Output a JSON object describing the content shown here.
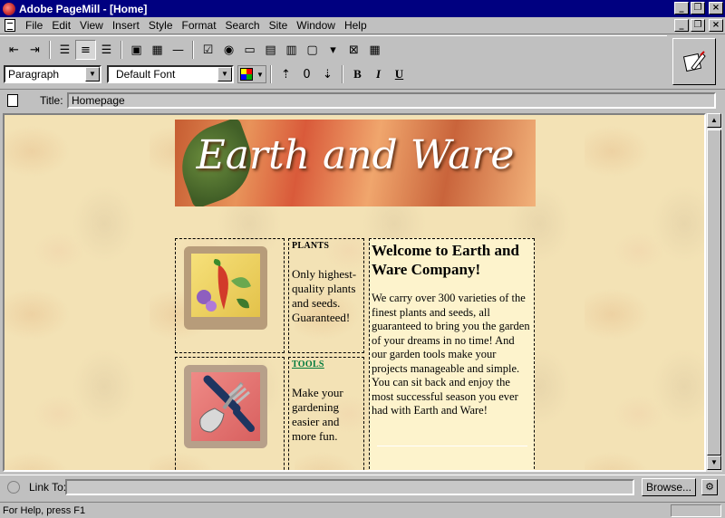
{
  "window": {
    "title": "Adobe PageMill - [Home]"
  },
  "menu": {
    "items": [
      {
        "label": "File"
      },
      {
        "label": "Edit"
      },
      {
        "label": "View"
      },
      {
        "label": "Insert"
      },
      {
        "label": "Style"
      },
      {
        "label": "Format"
      },
      {
        "label": "Search"
      },
      {
        "label": "Site"
      },
      {
        "label": "Window"
      },
      {
        "label": "Help"
      }
    ]
  },
  "toolbar": {
    "paragraph_format": "Paragraph",
    "font": "Default Font",
    "bold_label": "B",
    "italic_label": "I",
    "underline_label": "U",
    "font_size_glyph": "0"
  },
  "page": {
    "title_label": "Title:",
    "title_value": "Homepage"
  },
  "content": {
    "banner_text": "Earth and Ware",
    "plants": {
      "heading": "PLANTS",
      "text": "Only highest-quality plants and seeds. Guaranteed!"
    },
    "tools": {
      "heading": "TOOLS",
      "text": "Make your gardening easier and more fun."
    },
    "welcome": {
      "title": "Welcome to Earth and Ware Company!",
      "body": "We carry over 300 varieties of the finest plants and seeds, all guaranteed to bring you the garden of your dreams in no time! And our garden tools make your projects manageable and simple. You can sit back and enjoy the most successful season you ever had with Earth and Ware!"
    }
  },
  "link": {
    "label": "Link To:",
    "value": "",
    "browse_label": "Browse..."
  },
  "status": {
    "message": "For Help, press F1"
  }
}
